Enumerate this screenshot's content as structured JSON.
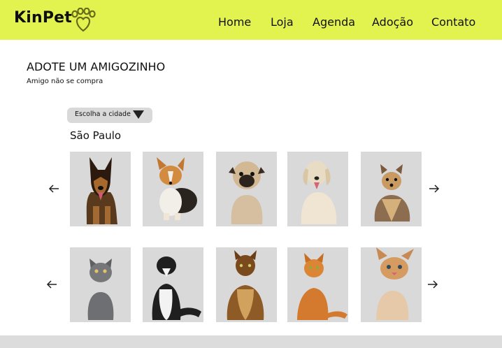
{
  "brand": {
    "name": "KinPet",
    "logo_icon": "paw-heart-icon",
    "accent": "#e2f34f"
  },
  "nav": {
    "items": [
      {
        "label": "Home"
      },
      {
        "label": "Loja"
      },
      {
        "label": "Agenda"
      },
      {
        "label": "Adoção"
      },
      {
        "label": "Contato"
      }
    ]
  },
  "page": {
    "title": "ADOTE UM AMIGOZINHO",
    "subtitle": "Amigo não se compra"
  },
  "filter": {
    "label": "Escolha a cidade",
    "icon": "caret-down-icon",
    "selected_city": "São Paulo"
  },
  "carousels": [
    {
      "kind": "dogs",
      "prev_icon": "arrow-left-icon",
      "next_icon": "arrow-right-icon",
      "items": [
        {
          "icon": "german-shepherd-photo"
        },
        {
          "icon": "corgi-photo"
        },
        {
          "icon": "pug-photo"
        },
        {
          "icon": "golden-retriever-photo"
        },
        {
          "icon": "yorkshire-terrier-photo"
        }
      ]
    },
    {
      "kind": "cats",
      "prev_icon": "arrow-left-icon",
      "next_icon": "arrow-right-icon",
      "items": [
        {
          "icon": "gray-kitten-photo"
        },
        {
          "icon": "black-white-cat-photo"
        },
        {
          "icon": "maine-coon-photo"
        },
        {
          "icon": "orange-tabby-photo"
        },
        {
          "icon": "tabby-kitten-photo"
        }
      ]
    }
  ]
}
